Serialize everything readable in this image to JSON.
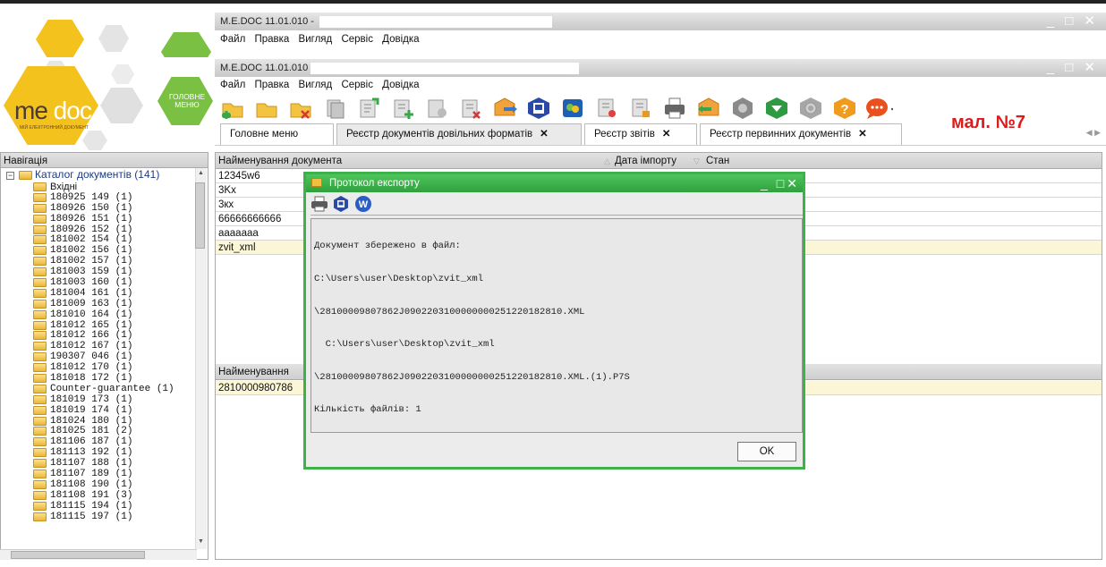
{
  "background_window": {
    "title": "M.E.DOC 11.01.010 - ",
    "menu": [
      "Файл",
      "Правка",
      "Вигляд",
      "Сервіс",
      "Довідка"
    ]
  },
  "window": {
    "title": "M.E.DOC 11.01.010",
    "menu": [
      "Файл",
      "Правка",
      "Вигляд",
      "Сервіс",
      "Довідка"
    ],
    "logo": {
      "text": "me doc",
      "tagline": "мій електронний документ"
    },
    "main_menu_tile": "ГОЛОВНЕ МЕНЮ",
    "toolbar_icons": [
      "new-document-icon",
      "open-folder-icon",
      "delete-document-icon",
      "copy-icon",
      "edit-icon",
      "add-icon",
      "properties-icon",
      "remove-icon",
      "send-envelope-icon",
      "save-disk-icon",
      "sign-icon",
      "stamp-icon",
      "lock-icon",
      "print-icon",
      "receive-envelope-icon",
      "gear-icon",
      "mail-green-icon",
      "settings-gray-icon",
      "help-icon",
      "chat-icon"
    ]
  },
  "tabs": [
    {
      "label": "Головне меню",
      "closable": false
    },
    {
      "label": "Реєстр документів довільних форматів",
      "closable": true,
      "active": true
    },
    {
      "label": "Реєстр звітів",
      "closable": true
    },
    {
      "label": "Реєстр первинних документів",
      "closable": true
    }
  ],
  "annotation": "мал. №7",
  "navigation": {
    "header": "Навігація",
    "root": "Каталог документів (141)",
    "items": [
      "Вхідні",
      "180925 149 (1)",
      "180926 150 (1)",
      "180926 151 (1)",
      "180926 152 (1)",
      "181002 154 (1)",
      "181002 156 (1)",
      "181002 157 (1)",
      "181003 159 (1)",
      "181003 160 (1)",
      "181004 161 (1)",
      "181009 163 (1)",
      "181010 164 (1)",
      "181012 165 (1)",
      "181012 166 (1)",
      "181012 167 (1)",
      "190307 046 (1)",
      "181012 170 (1)",
      "181018 172 (1)",
      "Counter-guarantee (1)",
      "181019 173 (1)",
      "181019 174 (1)",
      "181024 180 (1)",
      "181025 181 (2)",
      "181106 187 (1)",
      "181113 192 (1)",
      "181107 188 (1)",
      "181107 189 (1)",
      "181108 190 (1)",
      "181108 191 (3)",
      "181115 194 (1)",
      "181115 197 (1)"
    ]
  },
  "documents": {
    "columns": [
      "Найменування документа",
      "Дата імпорту",
      "Стан"
    ],
    "rows": [
      "12345w6",
      "3Kx",
      "3кх",
      "66666666666",
      "aaaaaaa",
      "zvit_xml"
    ],
    "selected_index": 5
  },
  "files": {
    "columns": [
      "Найменування"
    ],
    "rows": [
      "2810000980786"
    ]
  },
  "dialog": {
    "title": "Протокол експорту",
    "tools": [
      "print-icon",
      "save-disk-icon",
      "word-export-icon"
    ],
    "lines": [
      "Документ збережено в файл:",
      "C:\\Users\\user\\Desktop\\zvit_xml",
      "\\28100009807862J0902203100000000251220182810.XML",
      "  C:\\Users\\user\\Desktop\\zvit_xml",
      "\\28100009807862J0902203100000000251220182810.XML.(1).P7S",
      "Кількість файлів: 1"
    ],
    "ok_label": "OK"
  },
  "colors": {
    "accent_green": "#3eb24a",
    "logo_yellow": "#f4c21c",
    "annotation_red": "#d91c1c"
  }
}
